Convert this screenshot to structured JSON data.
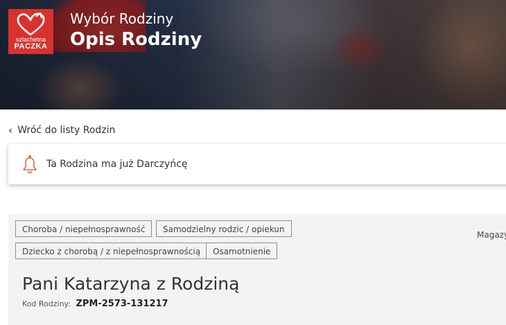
{
  "hero": {
    "subtitle": "Wybór Rodziny",
    "title": "Opis Rodziny",
    "logo_line1": "szlachetna",
    "logo_line2": "PACZKA"
  },
  "back_link": {
    "label": "Wróć do listy Rodzin"
  },
  "notice": {
    "text": "Ta Rodzina ma już Darczyńcę"
  },
  "tags": [
    "Choroba / niepełnosprawność",
    "Samodzielny rodzic / opiekun",
    "Dziecko z chorobą / z niepełnosprawnością",
    "Osamotnienie"
  ],
  "side_label": "Magazy",
  "family": {
    "name": "Pani Katarzyna z Rodziną",
    "code_label": "Kod Rodziny:",
    "code_value": "ZPM-2573-131217"
  },
  "colors": {
    "brand_red": "#d8322f",
    "bell": "#e0683a",
    "link_chevron": "#4a56c5"
  }
}
